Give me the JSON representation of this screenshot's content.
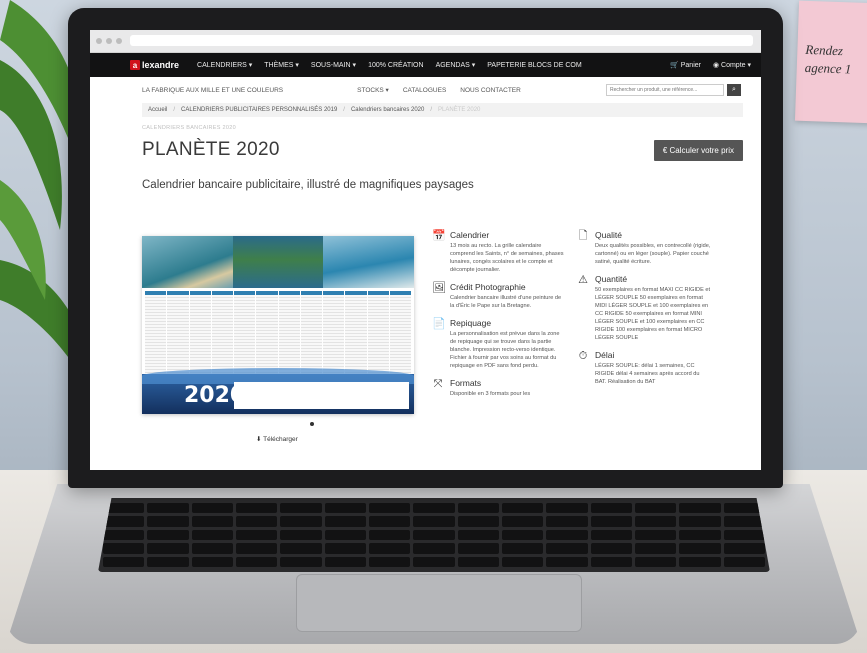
{
  "sticky_note": {
    "line1": "Rendez",
    "line2": "agence 1"
  },
  "site": {
    "logo_text": "lexandre",
    "logo_letter": "a",
    "nav": [
      "CALENDRIERS ▾",
      "THÈMES ▾",
      "SOUS-MAIN ▾",
      "100% CRÉATION",
      "AGENDAS ▾",
      "PAPETERIE BLOCS DE COM"
    ],
    "cart_label": "Panier",
    "account_label": "Compte ▾"
  },
  "subnav": {
    "tagline": "LA FABRIQUE AUX MILLE ET UNE COULEURS",
    "links": [
      "STOCKS ▾",
      "CATALOGUES",
      "NOUS CONTACTER"
    ],
    "search_placeholder": "Rechercher un produit, une référence..."
  },
  "breadcrumb": [
    "Accueil",
    "CALENDRIERS PUBLICITAIRES PERSONNALISÉS 2019",
    "Calendriers bancaires 2020",
    "PLANÈTE 2020"
  ],
  "product": {
    "kicker": "CALENDRIERS BANCAIRES 2020",
    "title": "PLANÈTE 2020",
    "calc_button": "€  Calculer votre prix",
    "subtitle": "Calendrier bancaire publicitaire, illustré de magnifiques paysages",
    "calendar_year": "2020",
    "download_label": "⬇ Télécharger"
  },
  "features_left": [
    {
      "icon": "calendar-icon",
      "glyph": "📅",
      "title": "Calendrier",
      "text": "13 mois au recto. La grille calendaire comprend les Saints, n° de semaines, phases lunaires, congés scolaires et le compte et décompte journalier."
    },
    {
      "icon": "image-icon",
      "glyph": "🖼",
      "title": "Crédit Photographie",
      "text": "Calendrier bancaire illustré d'une peinture de la d'Éric le Pape sur la Bretagne."
    },
    {
      "icon": "pdf-icon",
      "glyph": "📄",
      "title": "Repiquage",
      "text": "La personnalisation est prévue dans la zone de repiquage qui se trouve dans la partie blanche. Impression recto-verso identique. Fichier à fournir par vos soins au format du repiquage en PDF sans fond perdu."
    },
    {
      "icon": "expand-icon",
      "glyph": "⤧",
      "title": "Formats",
      "text": "Disponible en 3 formats pour les"
    }
  ],
  "features_right": [
    {
      "icon": "document-icon",
      "glyph": "🗋",
      "title": "Qualité",
      "text": "Deux qualités possibles, en contrecollé (rigide, cartonné) ou en léger (souple). Papier couché satiné, qualité écriture."
    },
    {
      "icon": "warning-icon",
      "glyph": "⚠",
      "title": "Quantité",
      "text": "50 exemplaires en format MAXI CC RIGIDE et LÉGER SOUPLE 50 exemplaires en format MIDI LÉGER SOUPLE et 100 exemplaires en CC RIGIDE 50 exemplaires en format MINI LÉGER SOUPLE et 100 exemplaires en CC RIGIDE 100 exemplaires en format MICRO LÉGER SOUPLE"
    },
    {
      "icon": "clock-icon",
      "glyph": "⏱",
      "title": "Délai",
      "text": "LÉGER SOUPLE: délai 1 semaines, CC RIGIDE délai 4 semaines après accord du BAT. Réalisation du BAT"
    }
  ]
}
